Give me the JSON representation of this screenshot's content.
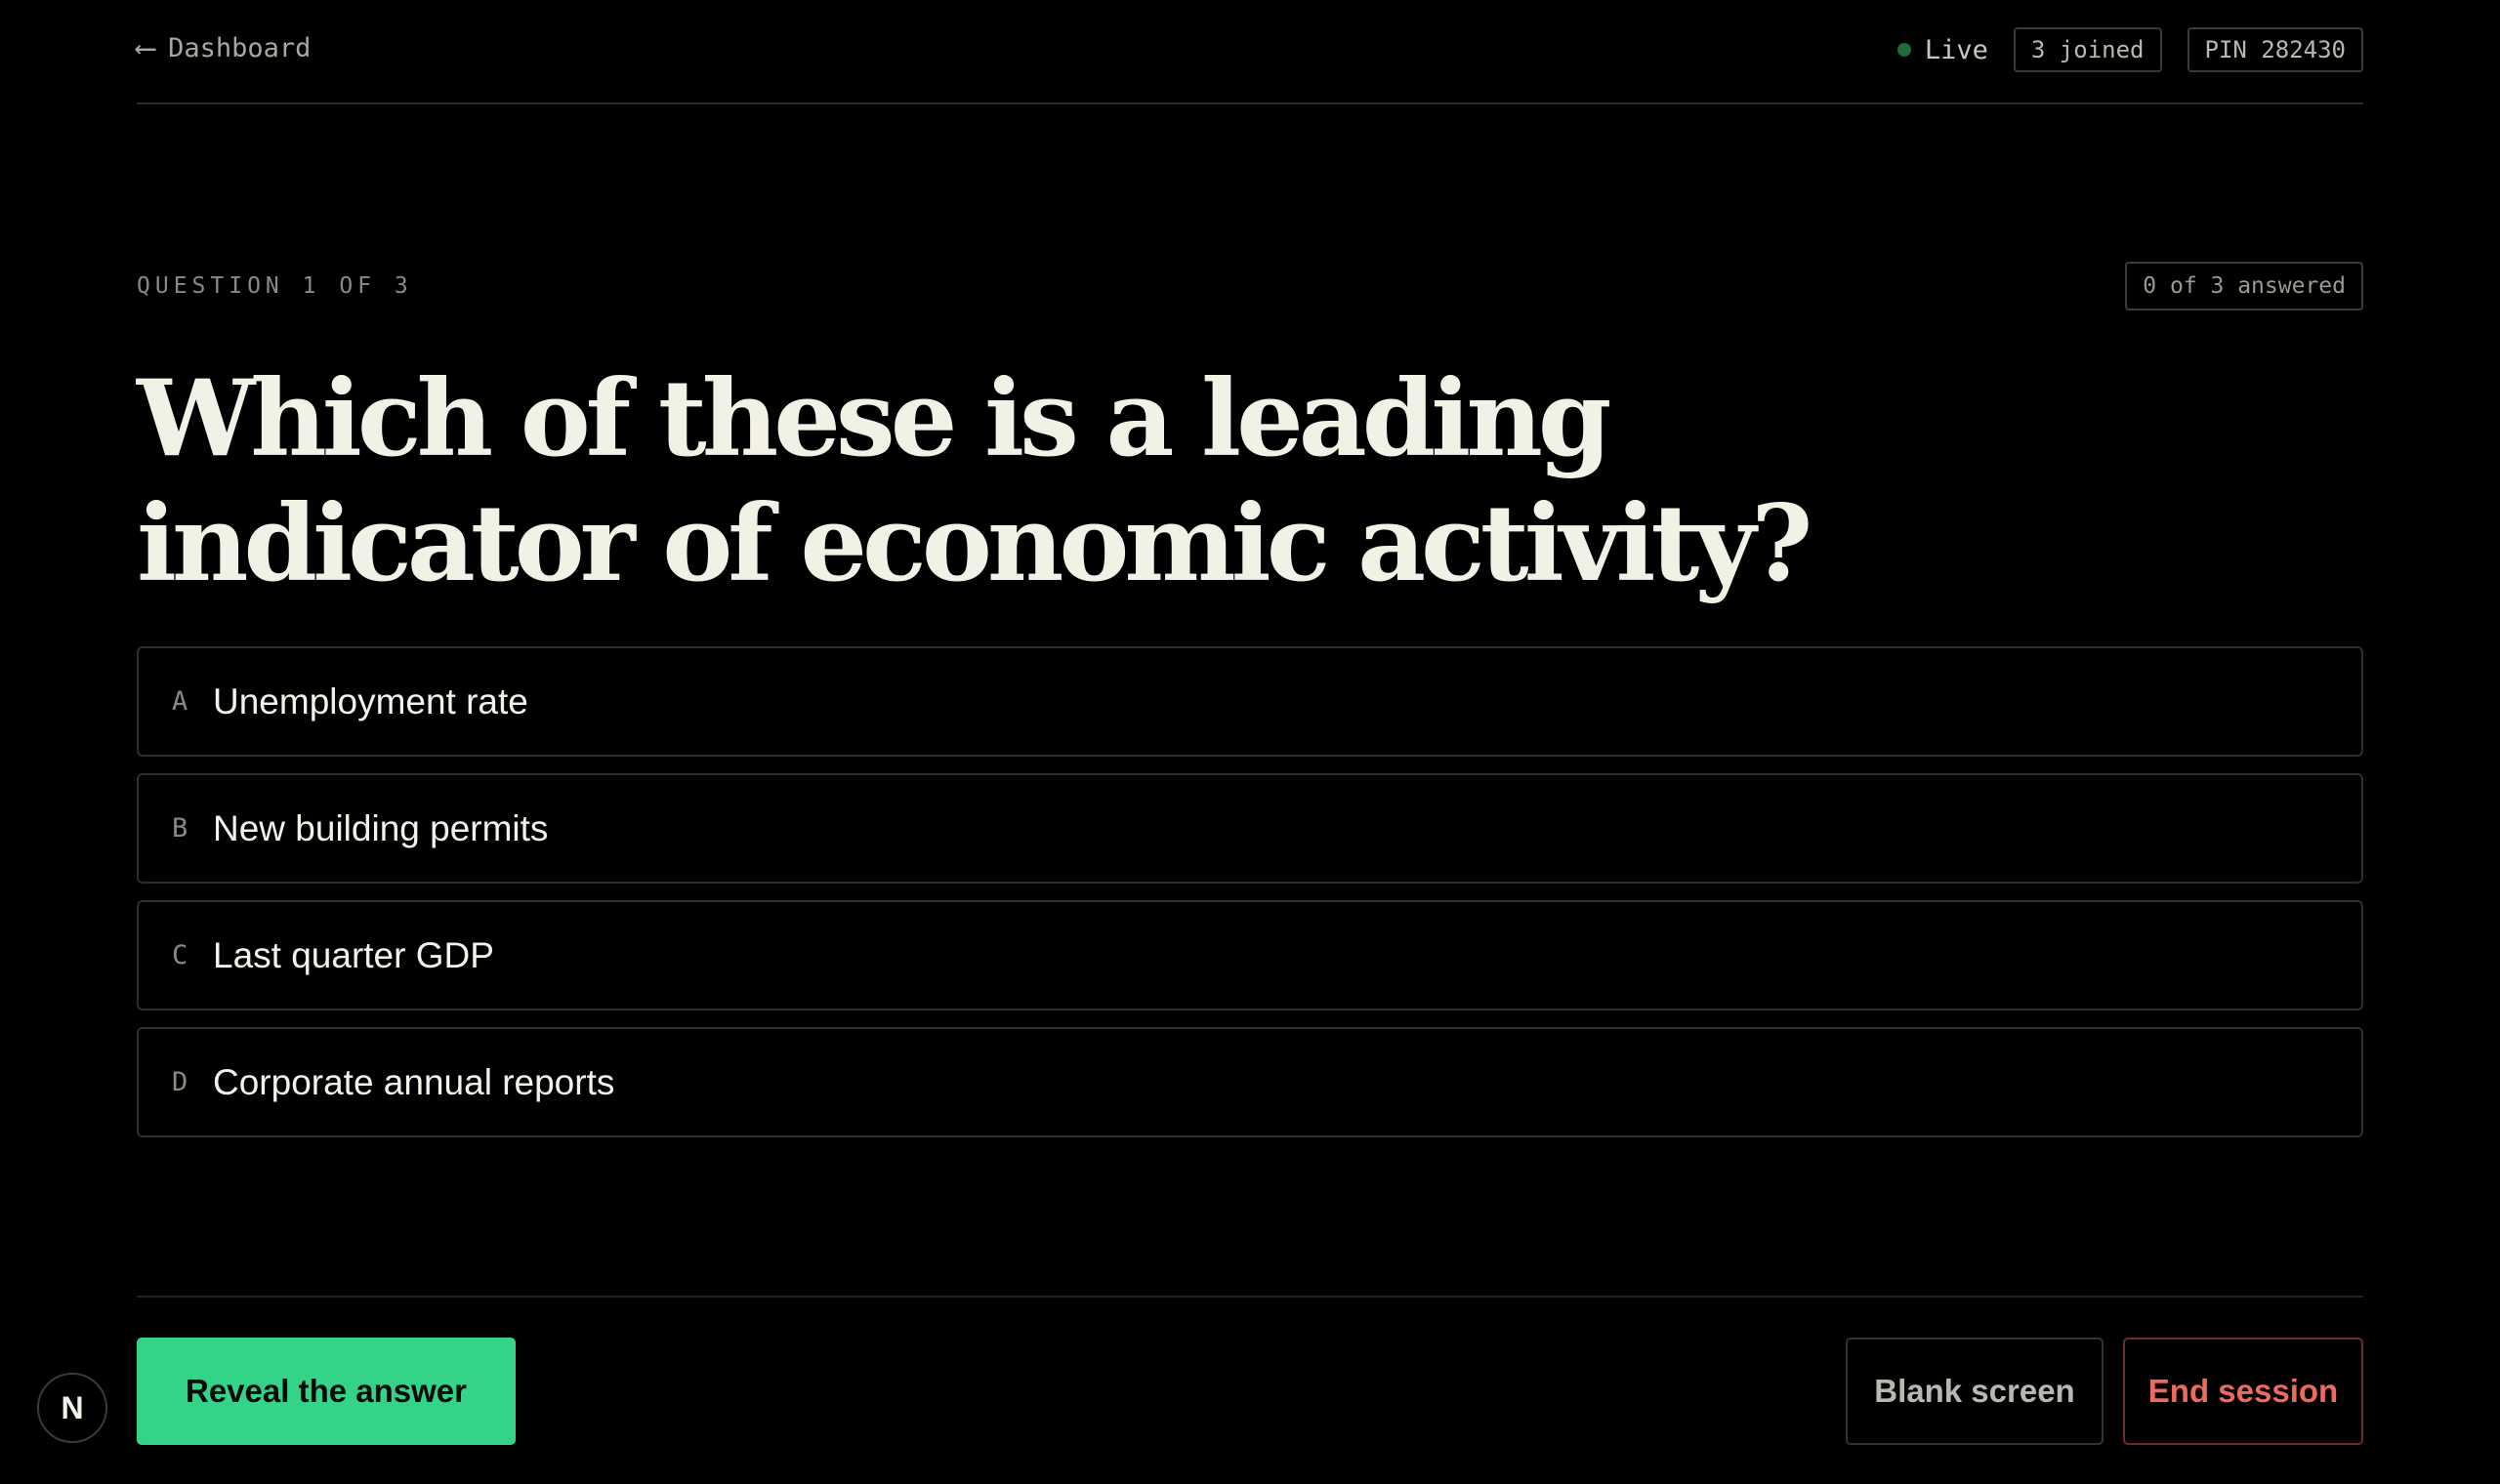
{
  "topbar": {
    "back_arrow": "⟵",
    "back_label": "Dashboard",
    "live_label": "Live",
    "joined_label": "3 joined",
    "pin_label": "PIN 282430"
  },
  "question": {
    "counter": "QUESTION 1 OF 3",
    "answered": "0 of 3 answered",
    "text": "Which of these is a leading indicator of economic activity?",
    "options": [
      {
        "letter": "A",
        "text": "Unemployment rate"
      },
      {
        "letter": "B",
        "text": "New building permits"
      },
      {
        "letter": "C",
        "text": "Last quarter GDP"
      },
      {
        "letter": "D",
        "text": "Corporate annual reports"
      }
    ]
  },
  "footer": {
    "reveal_label": "Reveal the answer",
    "blank_label": "Blank screen",
    "end_label": "End session"
  },
  "logo": {
    "letter": "N",
    "icon": "n-logo-icon"
  },
  "colors": {
    "background": "#000000",
    "accent_green": "#34d488",
    "live_dot": "#1f6b3a",
    "danger": "#ee6a5c"
  }
}
